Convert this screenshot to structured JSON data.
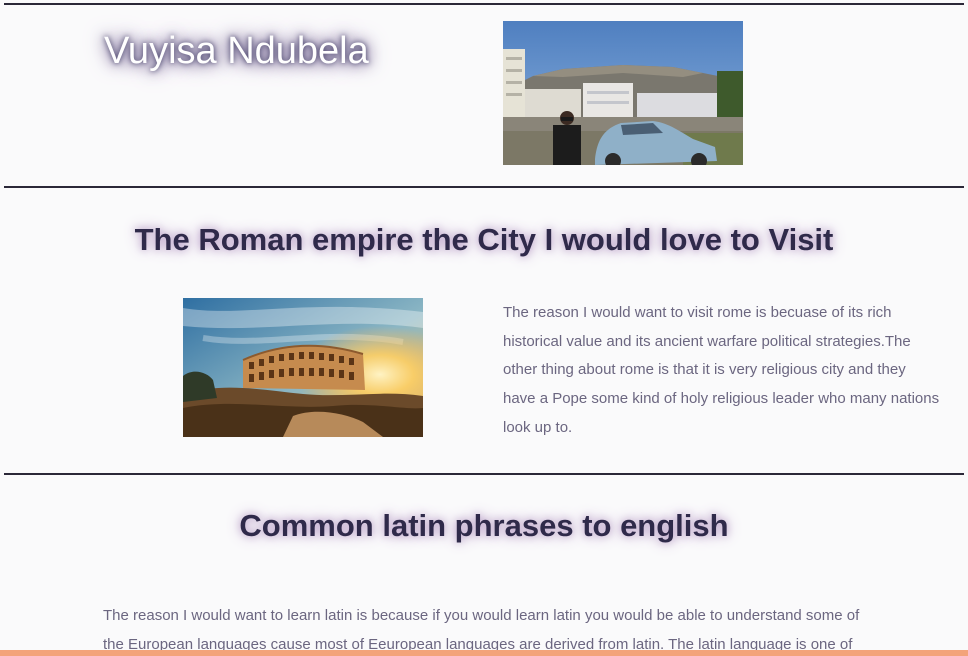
{
  "header": {
    "name": "Vuyisa Ndubela"
  },
  "rome_section": {
    "title": "The Roman empire the City I would love to Visit",
    "paragraph": "The reason I would want to visit rome is becuase of its rich historical value and its ancient warfare political strategies.The other thing about rome is that it is very religious city and they have a Pope some kind of holy religious leader who many nations look up to."
  },
  "latin_section": {
    "title": "Common latin phrases to english",
    "paragraph": "The reason I would want to learn latin is because if you would learn latin you would be able to understand some of the European languages cause most of Eeuropean languages are derived from latin. The latin language is one of"
  },
  "colors": {
    "rule": "#2b2838",
    "title": "#2f2a4a",
    "text": "#6b6680",
    "bottom_bar": "#f3a37a",
    "background": "#fafafb"
  }
}
